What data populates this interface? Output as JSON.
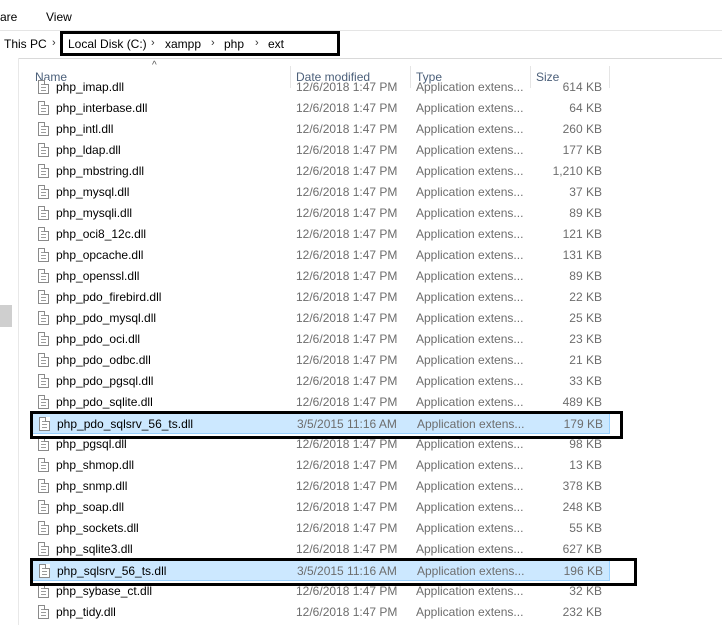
{
  "ribbon": {
    "share_label": "are",
    "view_label": "View"
  },
  "address": {
    "this_pc": "This PC",
    "crumbs": [
      "Local Disk (C:)",
      "xampp",
      "php",
      "ext"
    ]
  },
  "columns": {
    "name": "Name",
    "date": "Date modified",
    "type": "Type",
    "size": "Size"
  },
  "files": [
    {
      "name": "php_imap.dll",
      "date": "12/6/2018 1:47 PM",
      "type": "Application extens...",
      "size": "614 KB"
    },
    {
      "name": "php_interbase.dll",
      "date": "12/6/2018 1:47 PM",
      "type": "Application extens...",
      "size": "64 KB"
    },
    {
      "name": "php_intl.dll",
      "date": "12/6/2018 1:47 PM",
      "type": "Application extens...",
      "size": "260 KB"
    },
    {
      "name": "php_ldap.dll",
      "date": "12/6/2018 1:47 PM",
      "type": "Application extens...",
      "size": "177 KB"
    },
    {
      "name": "php_mbstring.dll",
      "date": "12/6/2018 1:47 PM",
      "type": "Application extens...",
      "size": "1,210 KB"
    },
    {
      "name": "php_mysql.dll",
      "date": "12/6/2018 1:47 PM",
      "type": "Application extens...",
      "size": "37 KB"
    },
    {
      "name": "php_mysqli.dll",
      "date": "12/6/2018 1:47 PM",
      "type": "Application extens...",
      "size": "89 KB"
    },
    {
      "name": "php_oci8_12c.dll",
      "date": "12/6/2018 1:47 PM",
      "type": "Application extens...",
      "size": "121 KB"
    },
    {
      "name": "php_opcache.dll",
      "date": "12/6/2018 1:47 PM",
      "type": "Application extens...",
      "size": "131 KB"
    },
    {
      "name": "php_openssl.dll",
      "date": "12/6/2018 1:47 PM",
      "type": "Application extens...",
      "size": "89 KB"
    },
    {
      "name": "php_pdo_firebird.dll",
      "date": "12/6/2018 1:47 PM",
      "type": "Application extens...",
      "size": "22 KB"
    },
    {
      "name": "php_pdo_mysql.dll",
      "date": "12/6/2018 1:47 PM",
      "type": "Application extens...",
      "size": "25 KB"
    },
    {
      "name": "php_pdo_oci.dll",
      "date": "12/6/2018 1:47 PM",
      "type": "Application extens...",
      "size": "23 KB"
    },
    {
      "name": "php_pdo_odbc.dll",
      "date": "12/6/2018 1:47 PM",
      "type": "Application extens...",
      "size": "21 KB"
    },
    {
      "name": "php_pdo_pgsql.dll",
      "date": "12/6/2018 1:47 PM",
      "type": "Application extens...",
      "size": "33 KB"
    },
    {
      "name": "php_pdo_sqlite.dll",
      "date": "12/6/2018 1:47 PM",
      "type": "Application extens...",
      "size": "489 KB"
    },
    {
      "name": "php_pdo_sqlsrv_56_ts.dll",
      "date": "3/5/2015 11:16 AM",
      "type": "Application extens...",
      "size": "179 KB",
      "selected": true
    },
    {
      "name": "php_pgsql.dll",
      "date": "12/6/2018 1:47 PM",
      "type": "Application extens...",
      "size": "98 KB"
    },
    {
      "name": "php_shmop.dll",
      "date": "12/6/2018 1:47 PM",
      "type": "Application extens...",
      "size": "13 KB"
    },
    {
      "name": "php_snmp.dll",
      "date": "12/6/2018 1:47 PM",
      "type": "Application extens...",
      "size": "378 KB"
    },
    {
      "name": "php_soap.dll",
      "date": "12/6/2018 1:47 PM",
      "type": "Application extens...",
      "size": "248 KB"
    },
    {
      "name": "php_sockets.dll",
      "date": "12/6/2018 1:47 PM",
      "type": "Application extens...",
      "size": "55 KB"
    },
    {
      "name": "php_sqlite3.dll",
      "date": "12/6/2018 1:47 PM",
      "type": "Application extens...",
      "size": "627 KB"
    },
    {
      "name": "php_sqlsrv_56_ts.dll",
      "date": "3/5/2015 11:16 AM",
      "type": "Application extens...",
      "size": "196 KB",
      "selected": true
    },
    {
      "name": "php_sybase_ct.dll",
      "date": "12/6/2018 1:47 PM",
      "type": "Application extens...",
      "size": "32 KB"
    },
    {
      "name": "php_tidy.dll",
      "date": "12/6/2018 1:47 PM",
      "type": "Application extens...",
      "size": "232 KB"
    }
  ]
}
